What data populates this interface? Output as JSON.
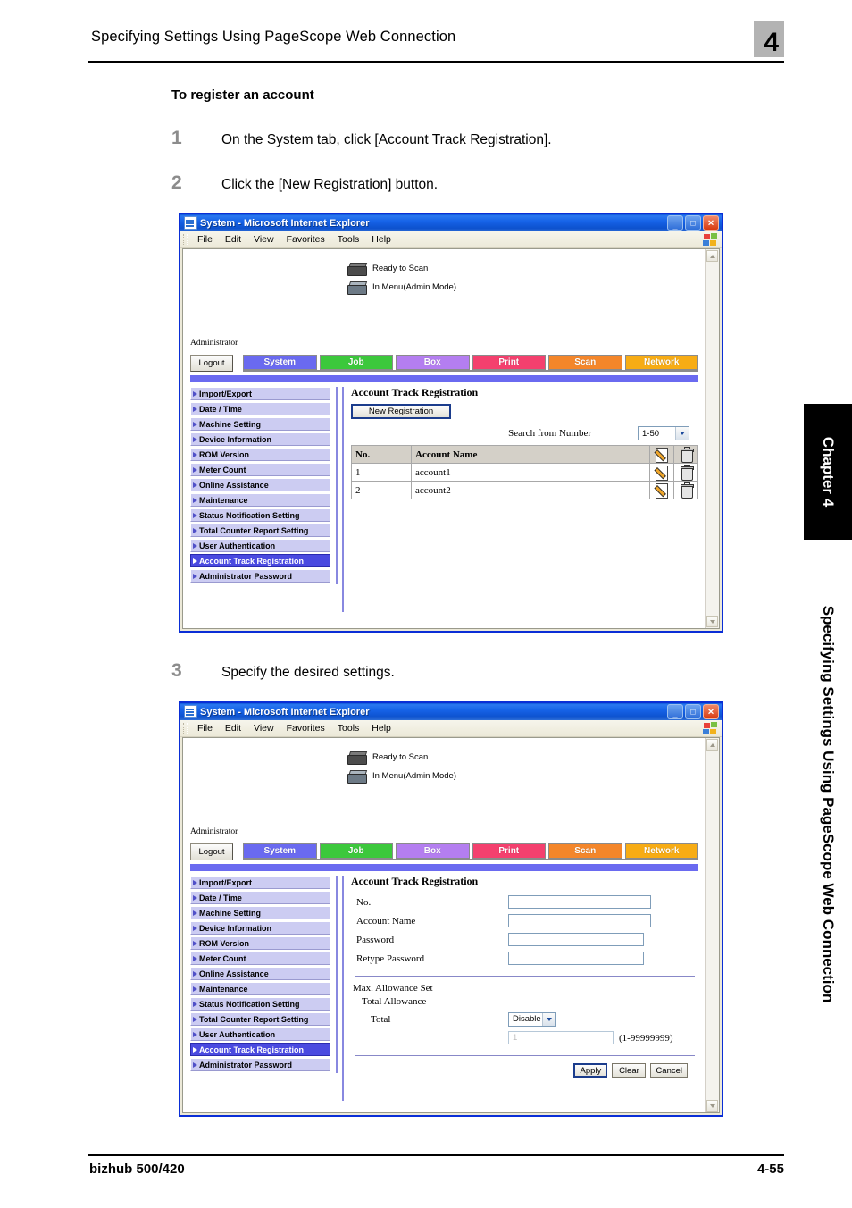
{
  "page": {
    "header_title": "Specifying Settings Using PageScope Web Connection",
    "chapter_number": "4",
    "section_title": "To register an account",
    "side_chapter_tab": "Chapter 4",
    "side_caption": "Specifying Settings Using PageScope Web Connection",
    "footer_left": "bizhub 500/420",
    "footer_right": "4-55"
  },
  "steps": [
    {
      "num": "1",
      "text": "On the System tab, click [Account Track Registration]."
    },
    {
      "num": "2",
      "text": "Click the [New Registration] button."
    },
    {
      "num": "3",
      "text": "Specify the desired settings."
    }
  ],
  "browser": {
    "title": "System - Microsoft Internet Explorer",
    "menus": [
      "File",
      "Edit",
      "View",
      "Favorites",
      "Tools",
      "Help"
    ],
    "window_buttons": {
      "minimize": "_",
      "maximize": "□",
      "close": "✕"
    }
  },
  "webui": {
    "status": [
      {
        "icon": "printer-icon",
        "text": "Ready to Scan"
      },
      {
        "icon": "scanner-icon",
        "text": "In Menu(Admin Mode)"
      }
    ],
    "admin_label": "Administrator",
    "logout_label": "Logout",
    "tabs": [
      {
        "label": "System",
        "color": "#6a6af0"
      },
      {
        "label": "Job",
        "color": "#3cc83c"
      },
      {
        "label": "Box",
        "color": "#b47ef0"
      },
      {
        "label": "Print",
        "color": "#f4406e"
      },
      {
        "label": "Scan",
        "color": "#f4862a"
      },
      {
        "label": "Network",
        "color": "#f7ac14"
      }
    ],
    "band_color": "#6a6af0",
    "menu_items": [
      "Import/Export",
      "Date / Time",
      "Machine Setting",
      "Device Information",
      "ROM Version",
      "Meter Count",
      "Online Assistance",
      "Maintenance",
      "Status Notification Setting",
      "Total Counter Report Setting",
      "User Authentication",
      "Account Track Registration",
      "Administrator Password"
    ],
    "active_menu_item": "Account Track Registration",
    "active_menu_color": "#4a4ae0"
  },
  "screen_list": {
    "content_title": "Account Track Registration",
    "new_registration_label": "New Registration",
    "search_label": "Search from Number",
    "search_value": "1-50",
    "table": {
      "columns": [
        "No.",
        "Account Name"
      ],
      "rows": [
        {
          "no": "1",
          "name": "account1"
        },
        {
          "no": "2",
          "name": "account2"
        }
      ],
      "edit_icon": "edit-pencil-icon",
      "delete_icon": "trash-icon"
    }
  },
  "screen_form": {
    "content_title": "Account Track Registration",
    "fields": [
      {
        "label": "No.",
        "value": ""
      },
      {
        "label": "Account Name",
        "value": ""
      },
      {
        "label": "Password",
        "value": ""
      },
      {
        "label": "Retype Password",
        "value": ""
      }
    ],
    "allowance_title": "Max. Allowance Set",
    "allowance_sub": "Total Allowance",
    "total_label": "Total",
    "total_select_value": "Disable",
    "total_input_value": "1",
    "range_note": "(1-99999999)",
    "buttons": [
      "Apply",
      "Clear",
      "Cancel"
    ]
  }
}
